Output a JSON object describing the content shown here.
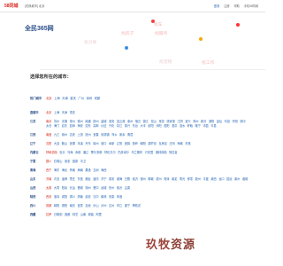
{
  "header": {
    "logo": "58同城",
    "current_city": "[切换城市] 北京",
    "links": [
      "登录",
      "注册",
      "帮助",
      "手机58同城"
    ]
  },
  "brand": {
    "title": "全民365网"
  },
  "banner": {
    "bubbles": [
      "找房子",
      "找服务",
      "找车",
      "找工作",
      "找对象",
      "找宠物"
    ]
  },
  "prompt": "选择您所在的城市：",
  "hot": {
    "label": "热门城市",
    "cities": [
      "北京",
      "上海",
      "天津",
      "重庆",
      "广州",
      "深圳",
      "成都"
    ]
  },
  "regions": [
    {
      "label": "直辖市",
      "cities": [
        "北京",
        "上海",
        "天津",
        "重庆"
      ]
    },
    {
      "label": "江苏",
      "cities": [
        "南京",
        "苏州",
        "无锡",
        "常州",
        "徐州",
        "南通",
        "扬州",
        "盐城",
        "淮安",
        "连云港",
        "泰州",
        "宿迁",
        "镇江",
        "昆山",
        "常熟",
        "张家港",
        "江阴",
        "宜兴",
        "邳州",
        "新沂",
        "溧阳",
        "金坛",
        "句容",
        "丹阳",
        "扬中",
        "太仓",
        "海门",
        "启东",
        "如皋",
        "海安",
        "如东",
        "高邮",
        "仪征",
        "兴化",
        "靖江",
        "泰兴",
        "东台",
        "大丰",
        "射阳",
        "沭阳",
        "泗阳",
        "泗洪",
        "涟水",
        "盱眙",
        "睢宁",
        "沛县",
        "丰县"
      ]
    },
    {
      "label": "江西",
      "cities": [
        "南昌",
        "九江",
        "赣州",
        "吉安",
        "上饶",
        "抚州",
        "宜春",
        "景德镇",
        "萍乡",
        "新余",
        "鹰潭"
      ]
    },
    {
      "label": "辽宁",
      "cities": [
        "沈阳",
        "大连",
        "鞍山",
        "抚顺",
        "本溪",
        "丹东",
        "锦州",
        "营口",
        "阜新",
        "辽阳",
        "盘锦",
        "铁岭",
        "朝阳",
        "葫芦岛",
        "瓦房店",
        "庄河",
        "海城",
        "东港"
      ]
    },
    {
      "label": "内蒙古",
      "cities": [
        "呼和浩特",
        "包头",
        "乌海",
        "赤峰",
        "通辽",
        "鄂尔多斯",
        "呼伦贝尔",
        "巴彦淖尔",
        "乌兰察布",
        "兴安盟",
        "锡林郭勒",
        "阿拉善"
      ]
    },
    {
      "label": "宁夏",
      "cities": [
        "银川",
        "石嘴山",
        "吴忠",
        "固原",
        "中卫"
      ]
    },
    {
      "label": "青海",
      "cities": [
        "西宁",
        "海东",
        "海北",
        "黄南",
        "海南",
        "果洛",
        "玉树",
        "海西"
      ]
    },
    {
      "label": "山东",
      "cities": [
        "济南",
        "青岛",
        "淄博",
        "枣庄",
        "东营",
        "烟台",
        "潍坊",
        "济宁",
        "泰安",
        "威海",
        "日照",
        "临沂",
        "德州",
        "聊城",
        "滨州",
        "菏泽",
        "莱芜",
        "寿光",
        "即墨",
        "胶州",
        "平度",
        "莱西",
        "龙口",
        "招远",
        "莱州",
        "诸城"
      ]
    },
    {
      "label": "山西",
      "cities": [
        "太原",
        "大同",
        "阳泉",
        "长治",
        "晋城",
        "朔州",
        "晋中",
        "运城",
        "忻州",
        "临汾",
        "吕梁"
      ]
    },
    {
      "label": "陕西",
      "cities": [
        "西安",
        "宝鸡",
        "咸阳",
        "铜川",
        "渭南",
        "延安",
        "汉中",
        "榆林",
        "安康",
        "商洛"
      ]
    },
    {
      "label": "四川",
      "cities": [
        "成都",
        "绵阳",
        "德阳",
        "南充",
        "宜宾",
        "自贡",
        "乐山",
        "泸州",
        "达州",
        "内江",
        "遂宁",
        "攀枝花"
      ]
    },
    {
      "label": "西藏",
      "cities": [
        "拉萨",
        "日喀则",
        "昌都",
        "林芝",
        "山南",
        "那曲",
        "阿里"
      ]
    }
  ],
  "watermark": {
    "part1": "玖牧",
    "part2": "资源"
  },
  "colors": {
    "accent": "#d8261c",
    "link": "#2766b5",
    "brand": "#2b4f8a"
  }
}
